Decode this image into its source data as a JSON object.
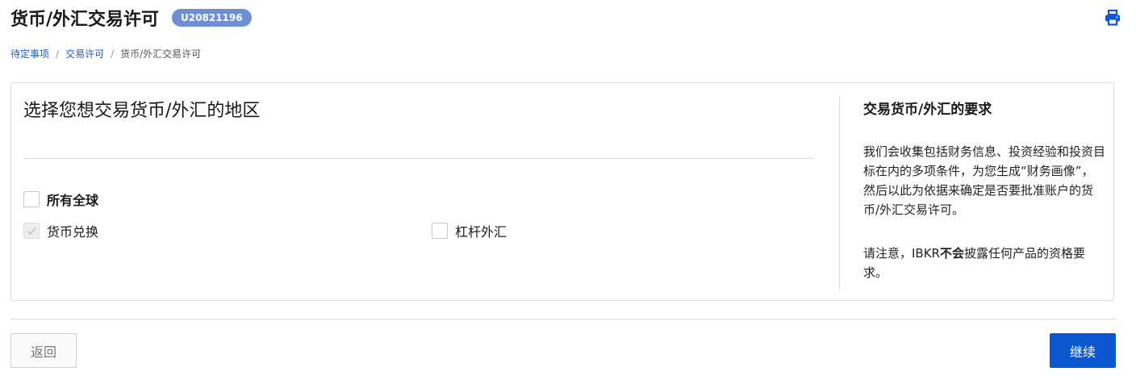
{
  "header": {
    "title": "货币/外汇交易许可",
    "account_id": "U20821196"
  },
  "breadcrumb": {
    "items": [
      "待定事项",
      "交易许可",
      "货币/外汇交易许可"
    ],
    "separator": "/"
  },
  "main": {
    "heading": "选择您想交易货币/外汇的地区",
    "checkboxes": [
      {
        "label": "所有全球",
        "checked": false,
        "disabled": false
      },
      {
        "label": "货币兑换",
        "checked": true,
        "disabled": true
      },
      {
        "label": "杠杆外汇",
        "checked": false,
        "disabled": false
      }
    ]
  },
  "sidebar": {
    "title": "交易货币/外汇的要求",
    "paragraph1": "我们会收集包括财务信息、投资经验和投资目标在内的多项条件，为您生成“财务画像”，然后以此为依据来确定是否要批准账户的货币/外汇交易许可。",
    "paragraph2_prefix": "请注意，IBKR",
    "paragraph2_bold": "不会",
    "paragraph2_suffix": "披露任何产品的资格要求。"
  },
  "footer": {
    "back_label": "返回",
    "continue_label": "继续"
  },
  "colors": {
    "primary": "#0b57d0",
    "link": "#1f5bc6",
    "badge": "#6e8fd6"
  }
}
